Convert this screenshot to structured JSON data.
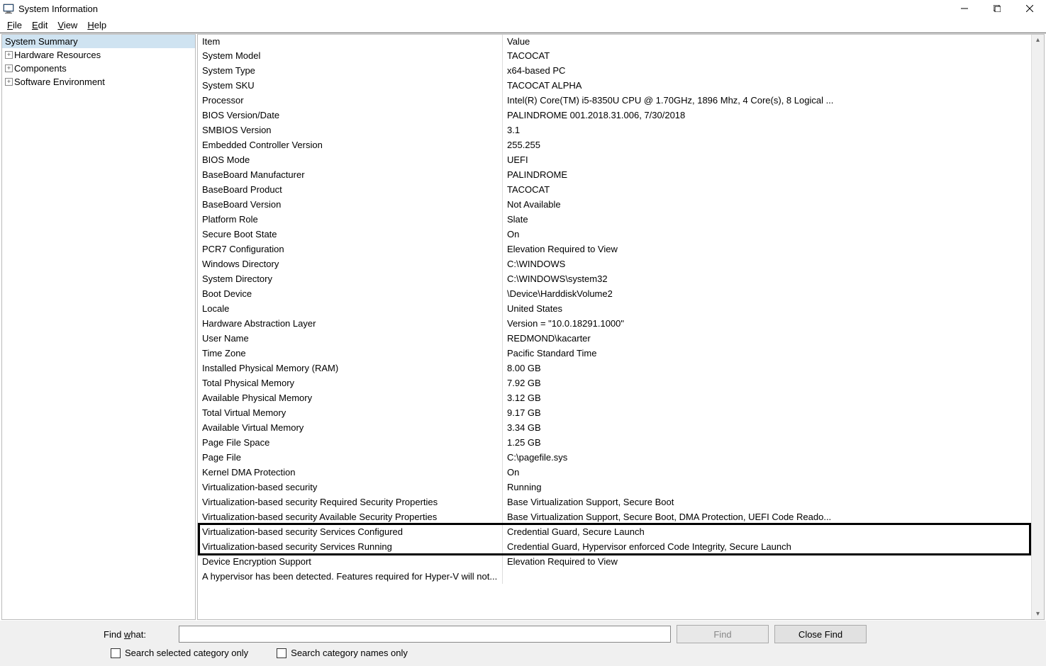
{
  "window": {
    "title": "System Information"
  },
  "menubar": {
    "file": "File",
    "edit": "Edit",
    "view": "View",
    "help": "Help"
  },
  "tree": {
    "summary": "System Summary",
    "hardware": "Hardware Resources",
    "components": "Components",
    "software": "Software Environment"
  },
  "list": {
    "header_item": "Item",
    "header_value": "Value",
    "rows": [
      {
        "item": "System Model",
        "value": "TACOCAT"
      },
      {
        "item": "System Type",
        "value": "x64-based PC"
      },
      {
        "item": "System SKU",
        "value": "TACOCAT ALPHA"
      },
      {
        "item": "Processor",
        "value": "Intel(R) Core(TM) i5-8350U CPU @ 1.70GHz, 1896 Mhz, 4 Core(s), 8 Logical ..."
      },
      {
        "item": "BIOS Version/Date",
        "value": "PALINDROME 001.2018.31.006, 7/30/2018"
      },
      {
        "item": "SMBIOS Version",
        "value": "3.1"
      },
      {
        "item": "Embedded Controller Version",
        "value": "255.255"
      },
      {
        "item": "BIOS Mode",
        "value": "UEFI"
      },
      {
        "item": "BaseBoard Manufacturer",
        "value": "PALINDROME"
      },
      {
        "item": "BaseBoard Product",
        "value": "TACOCAT"
      },
      {
        "item": "BaseBoard Version",
        "value": "Not Available"
      },
      {
        "item": "Platform Role",
        "value": "Slate"
      },
      {
        "item": "Secure Boot State",
        "value": "On"
      },
      {
        "item": "PCR7 Configuration",
        "value": "Elevation Required to View"
      },
      {
        "item": "Windows Directory",
        "value": "C:\\WINDOWS"
      },
      {
        "item": "System Directory",
        "value": "C:\\WINDOWS\\system32"
      },
      {
        "item": "Boot Device",
        "value": "\\Device\\HarddiskVolume2"
      },
      {
        "item": "Locale",
        "value": "United States"
      },
      {
        "item": "Hardware Abstraction Layer",
        "value": "Version = \"10.0.18291.1000\""
      },
      {
        "item": "User Name",
        "value": "REDMOND\\kacarter"
      },
      {
        "item": "Time Zone",
        "value": "Pacific Standard Time"
      },
      {
        "item": "Installed Physical Memory (RAM)",
        "value": "8.00 GB"
      },
      {
        "item": "Total Physical Memory",
        "value": "7.92 GB"
      },
      {
        "item": "Available Physical Memory",
        "value": "3.12 GB"
      },
      {
        "item": "Total Virtual Memory",
        "value": "9.17 GB"
      },
      {
        "item": "Available Virtual Memory",
        "value": "3.34 GB"
      },
      {
        "item": "Page File Space",
        "value": "1.25 GB"
      },
      {
        "item": "Page File",
        "value": "C:\\pagefile.sys"
      },
      {
        "item": "Kernel DMA Protection",
        "value": "On"
      },
      {
        "item": "Virtualization-based security",
        "value": "Running"
      },
      {
        "item": "Virtualization-based security Required Security Properties",
        "value": "Base Virtualization Support, Secure Boot"
      },
      {
        "item": "Virtualization-based security Available Security Properties",
        "value": "Base Virtualization Support, Secure Boot, DMA Protection, UEFI Code Reado..."
      },
      {
        "item": "Virtualization-based security Services Configured",
        "value": "Credential Guard, Secure Launch"
      },
      {
        "item": "Virtualization-based security Services Running",
        "value": "Credential Guard, Hypervisor enforced Code Integrity, Secure Launch"
      },
      {
        "item": "Device Encryption Support",
        "value": "Elevation Required to View"
      },
      {
        "item": "A hypervisor has been detected. Features required for Hyper-V will not...",
        "value": ""
      }
    ]
  },
  "findbar": {
    "label_prefix": "Find ",
    "label_letter": "w",
    "label_suffix": "hat:",
    "find_btn_prefix": "F",
    "find_btn_letter": "i",
    "find_btn_suffix": "nd",
    "close_btn_prefix": "",
    "close_btn_letter": "C",
    "close_btn_suffix": "lose Find",
    "cb1": "Search selected category only",
    "cb2": "Search category names only"
  }
}
